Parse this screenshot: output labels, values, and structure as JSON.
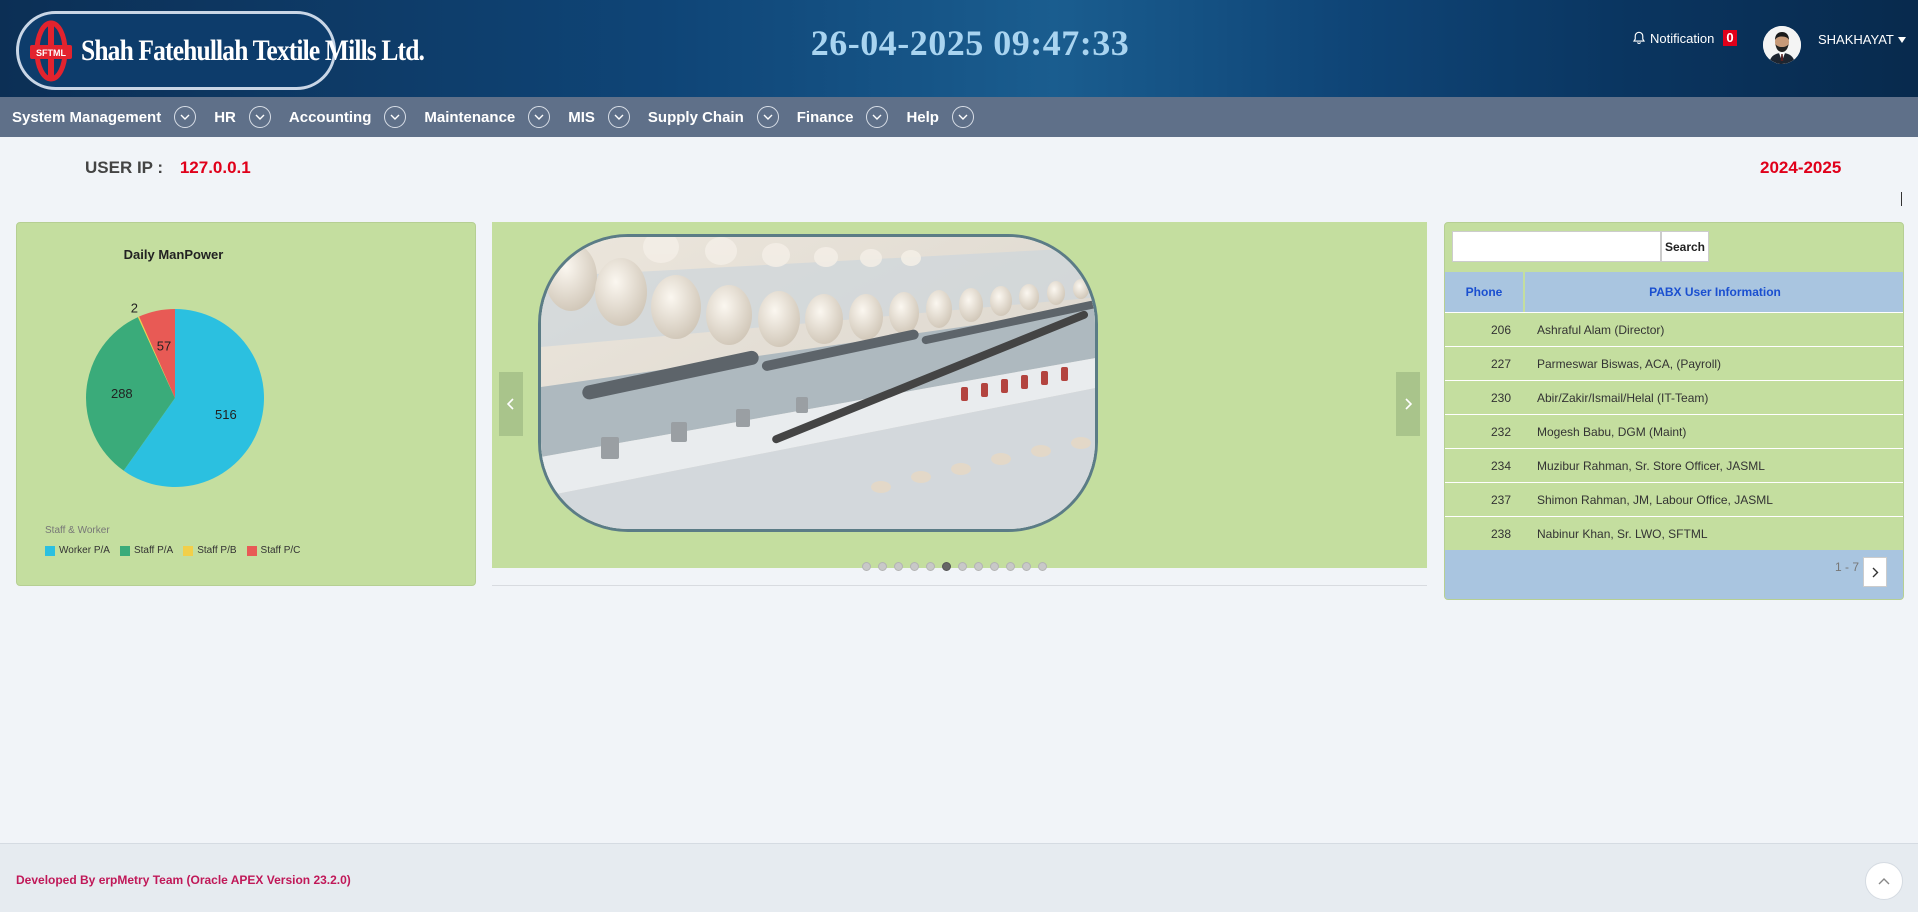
{
  "header": {
    "logo_name": "Shah Fatehullah Textile Mills Ltd.",
    "logo_badge": "SFTML",
    "datetime": "26-04-2025 09:47:33",
    "notification_label": "Notification",
    "notification_count": "0",
    "username": "SHAKHAYAT"
  },
  "nav": {
    "items": [
      {
        "label": "System Management"
      },
      {
        "label": "HR"
      },
      {
        "label": "Accounting"
      },
      {
        "label": "Maintenance"
      },
      {
        "label": "MIS"
      },
      {
        "label": "Supply Chain"
      },
      {
        "label": "Finance"
      },
      {
        "label": "Help"
      }
    ]
  },
  "info": {
    "user_ip_label": "USER IP :",
    "user_ip_value": "127.0.0.1",
    "fiscal_year": "2024-2025"
  },
  "chart_data": {
    "type": "pie",
    "title": "Daily ManPower",
    "legend_title": "Staff & Worker",
    "categories": [
      "Worker P/A",
      "Staff P/A",
      "Staff P/B",
      "Staff P/C"
    ],
    "values": [
      516,
      288,
      2,
      57
    ],
    "colors": [
      "#2bc0e0",
      "#3aab7a",
      "#f2cf4a",
      "#e85a55"
    ],
    "legend_position": "bottom-left"
  },
  "carousel": {
    "image_name": "textile-spinning-machines",
    "slide_count": 12,
    "active_index": 5,
    "prev_icon": "chevron-left-icon",
    "next_icon": "chevron-right-icon"
  },
  "pabx": {
    "search_button": "Search",
    "search_value": "",
    "columns": [
      "Phone",
      "PABX User Information"
    ],
    "rows": [
      {
        "phone": "206",
        "info": "Ashraful Alam (Director)"
      },
      {
        "phone": "227",
        "info": "Parmeswar Biswas, ACA, (Payroll)"
      },
      {
        "phone": "230",
        "info": "Abir/Zakir/Ismail/Helal (IT-Team)"
      },
      {
        "phone": "232",
        "info": "Mogesh Babu, DGM (Maint)"
      },
      {
        "phone": "234",
        "info": "Muzibur Rahman, Sr. Store Officer, JASML"
      },
      {
        "phone": "237",
        "info": "Shimon Rahman, JM, Labour Office, JASML"
      },
      {
        "phone": "238",
        "info": "Nabinur Khan, Sr. LWO, SFTML"
      }
    ],
    "pagination": "1 - 7"
  },
  "footer": {
    "text": "Developed By erpMetry Team (Oracle APEX Version 23.2.0)"
  }
}
